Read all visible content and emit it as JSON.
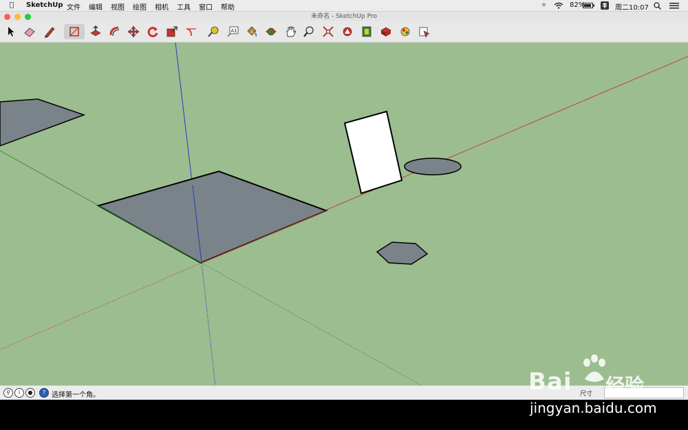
{
  "menubar": {
    "app_name": "SketchUp",
    "items": [
      "文件",
      "编辑",
      "视图",
      "绘图",
      "相机",
      "工具",
      "窗口",
      "帮助"
    ],
    "battery": "82%",
    "clock": "周二10:07"
  },
  "window": {
    "title": "未命名 - SketchUp Pro"
  },
  "toolbar": {
    "tools": [
      "select-icon",
      "eraser-icon",
      "pencil-line-icon",
      "rectangle-icon",
      "push-pull-icon",
      "offset-icon",
      "move-icon",
      "rotate-icon",
      "scale-icon",
      "arc-icon",
      "tape-measure-icon",
      "text-icon",
      "paint-bucket-icon",
      "orbit-icon",
      "pan-icon",
      "zoom-icon",
      "zoom-extents-icon",
      "warehouse-icon",
      "extension-icon",
      "components-icon",
      "styles-icon",
      "layout-icon"
    ],
    "active_tool": "rectangle-icon"
  },
  "status": {
    "message": "选择第一个角。",
    "measure_label": "尺寸"
  },
  "watermark": {
    "brand": "Bai",
    "brand_cn": "经验",
    "url": "jingyan.baidu.com"
  },
  "colors": {
    "viewport_bg": "#9cbd8f",
    "face": "#7a838a",
    "red_axis": "#c0392b",
    "green_axis": "#2e8b2e",
    "blue_axis": "#1f3fbf"
  }
}
